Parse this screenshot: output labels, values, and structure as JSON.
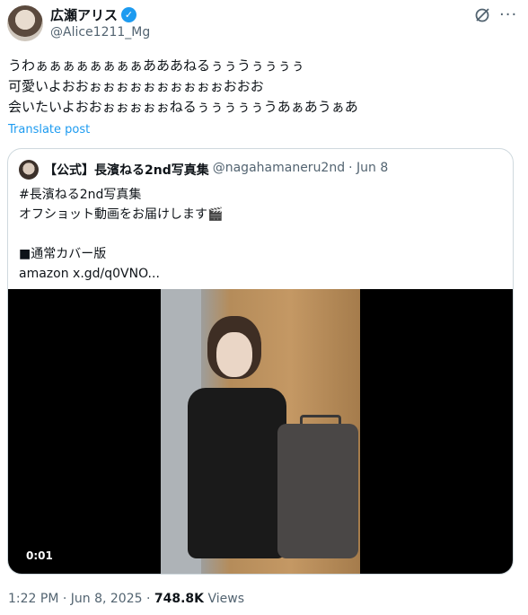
{
  "author": {
    "name": "広瀬アリス",
    "handle": "@Alice1211_Mg"
  },
  "post_lines": [
    "うわぁぁぁぁぁぁぁぁあああねるぅぅうぅぅぅぅ",
    "可愛いよおおぉぉぉぉぉぉぉぉぉぉおおお",
    "会いたいよおおぉぉぉぉぉねるぅぅぅぅぅうあぁあうぁあ"
  ],
  "translate_label": "Translate post",
  "quote": {
    "name": "【公式】長濱ねる2nd写真集",
    "handle": "@nagahamaneru2nd",
    "date": "· Jun 8",
    "lines": [
      "#長濱ねる2nd写真集",
      "オフショット動画をお届けします🎬",
      "",
      "■通常カバー版",
      "amazon x.gd/q0VNO..."
    ]
  },
  "video": {
    "time": "0:01"
  },
  "footer": {
    "time": "1:22 PM · Jun 8, 2025 · ",
    "views_count": "748.8K",
    "views_label": " Views"
  }
}
